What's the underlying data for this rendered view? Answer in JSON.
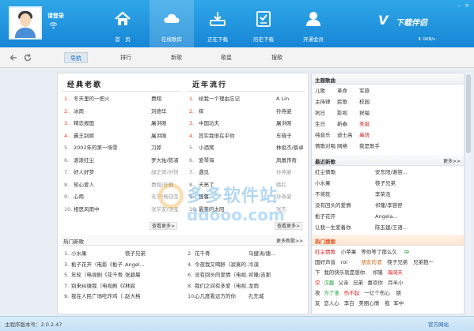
{
  "header": {
    "login_text": "请登录",
    "logo_text": "下载伴侣",
    "logo_mark": "V",
    "speed": "0KB/s",
    "nav": [
      {
        "label": "首　页",
        "icon": "home-icon"
      },
      {
        "label": "在线歌库",
        "icon": "cloud-icon"
      },
      {
        "label": "正在下载",
        "icon": "download-icon"
      },
      {
        "label": "历史下载",
        "icon": "history-icon"
      },
      {
        "label": "开通会员",
        "icon": "member-icon"
      }
    ]
  },
  "tabs": [
    "导航",
    "排行",
    "新歌",
    "歌星",
    "搜歌"
  ],
  "classic": {
    "title": "经典老歌",
    "more": "查看更多>",
    "songs": [
      {
        "n": "1.",
        "title": "冬天里的一把火",
        "artist": "费翔"
      },
      {
        "n": "2.",
        "title": "冰雨",
        "artist": "刘德华"
      },
      {
        "n": "3.",
        "title": "精忠报国",
        "artist": "屠洪刚"
      },
      {
        "n": "4.",
        "title": "霸王别姬",
        "artist": "屠洪刚"
      },
      {
        "n": "5.",
        "title": "2002年的第一场雪",
        "artist": "刀郎"
      },
      {
        "n": "6.",
        "title": "滚滚红尘",
        "artist": "罗大佑/陈淑..."
      },
      {
        "n": "7.",
        "title": "好人好梦",
        "artist": "邰正宵/孙悦"
      },
      {
        "n": "8.",
        "title": "知心爱人",
        "artist": "费翔/任静"
      },
      {
        "n": "9.",
        "title": "心雨",
        "artist": "毛宁/杨钰莹"
      },
      {
        "n": "10.",
        "title": "相思风雨中",
        "artist": "张学友/汤宝..."
      }
    ]
  },
  "recent": {
    "title": "近年流行",
    "more": "查看更多>",
    "songs": [
      {
        "n": "1.",
        "title": "给我一个理由忘记",
        "artist": "A Lin"
      },
      {
        "n": "2.",
        "title": "痒",
        "artist": "孙燕姿"
      },
      {
        "n": "3.",
        "title": "中国功夫",
        "artist": "屠洪刚"
      },
      {
        "n": "4.",
        "title": "其实我很在乎你",
        "artist": "车晓子"
      },
      {
        "n": "5.",
        "title": "小酒窝",
        "artist": "林俊杰/蔡卓..."
      },
      {
        "n": "6.",
        "title": "爱琴海",
        "artist": "凤凰传奇"
      },
      {
        "n": "7.",
        "title": "遇见",
        "artist": "孙燕姿"
      },
      {
        "n": "8.",
        "title": "天亮了",
        "artist": "韩红"
      },
      {
        "n": "9.",
        "title": "怪鲁",
        "artist": "孙燕姿"
      },
      {
        "n": "10.",
        "title": "最美的太阳",
        "artist": "张杰"
      }
    ]
  },
  "hot_new": {
    "title": "热门新歌",
    "more": "更多新歌>>",
    "left": [
      {
        "n": "1.",
        "title": "小水果",
        "artist": "筷子兄弟"
      },
      {
        "n": "3.",
        "title": "栀子花开（电影《栀子...",
        "artist": "Angel..."
      },
      {
        "n": "5.",
        "title": "年轮（电视剧《花千骨...",
        "artist": "张碧晨"
      },
      {
        "n": "7.",
        "title": "别来纠缠我（电视剧《花...",
        "artist": "林宸"
      },
      {
        "n": "9.",
        "title": "我在人民广场吃炸鸡（...",
        "artist": "赵大格"
      }
    ],
    "right": [
      {
        "n": "2.",
        "title": "花千骨",
        "artist": "马健涛/唐..."
      },
      {
        "n": "4.",
        "title": "今夜我又喝醉（寂寞的...",
        "artist": "冷漠"
      },
      {
        "n": "6.",
        "title": "没有回头的爱情（电视...",
        "artist": "祁隆/吉那"
      },
      {
        "n": "8.",
        "title": "我们之间有多爱（电视...",
        "artist": "龙雨"
      },
      {
        "n": "10.",
        "title": "心几度看远方的你",
        "artist": "孔先城"
      }
    ]
  },
  "sidebar": {
    "topic_title": "主题歌曲",
    "topics": [
      {
        "text": "儿歌",
        "red": false
      },
      {
        "text": "革命",
        "red": false
      },
      {
        "text": "军旅",
        "red": false
      },
      {
        "text": "主持律",
        "red": false
      },
      {
        "text": "民歌",
        "red": false
      },
      {
        "text": "校园",
        "red": false
      },
      {
        "text": "抗日",
        "red": false
      },
      {
        "text": "影视",
        "red": false
      },
      {
        "text": "祝福",
        "red": false
      },
      {
        "text": "生日",
        "red": false
      },
      {
        "text": "新春",
        "red": false
      },
      {
        "text": "圣诞",
        "red": true
      },
      {
        "text": "纯音乐",
        "red": false
      },
      {
        "text": "迪士高",
        "red": false
      },
      {
        "text": "串烧",
        "red": true
      },
      {
        "text": "情歌对唱",
        "red": false
      },
      {
        "text": "网络",
        "red": false
      },
      {
        "text": "我是歌手",
        "red": false
      }
    ],
    "recent_title": "最近新歌",
    "recent_more": "更多>>",
    "recent_songs": [
      "红尘情歌",
      "安东阳/谢容...",
      "小水果",
      "筷子兄弟",
      "不将就",
      "李荣浩",
      "没有回头的爱情",
      "祁隆/李容舒",
      "栀子花开",
      "Angela...",
      "让我一生爱着你",
      "陈玉建/王语..."
    ],
    "search_title": "热门搜索",
    "search_words": [
      {
        "text": "红尘情歌",
        "c": "#d21e1e"
      },
      {
        "text": "小苹果",
        "c": "#333"
      },
      {
        "text": "等你等了那么久",
        "c": "#333"
      },
      {
        "text": "中",
        "c": "#1a9e3a"
      },
      {
        "text": "国好声音",
        "c": "#333"
      },
      {
        "text": "roi",
        "c": "#333"
      },
      {
        "text": "朋友的酒",
        "c": "#d2691e"
      },
      {
        "text": "筷子兄弟",
        "c": "#333"
      },
      {
        "text": "兄弟抱一",
        "c": "#333"
      },
      {
        "text": "下",
        "c": "#333"
      },
      {
        "text": "我的快乐就是想你",
        "c": "#333"
      },
      {
        "text": "祁隆",
        "c": "#333"
      },
      {
        "text": "海阔天",
        "c": "#d21e1e"
      },
      {
        "text": "空",
        "c": "#d21e1e"
      },
      {
        "text": "汉趣",
        "c": "#1a9e3a"
      },
      {
        "text": "父亲",
        "c": "#333"
      },
      {
        "text": "兄弟",
        "c": "#333"
      },
      {
        "text": "喜欢你",
        "c": "#333"
      },
      {
        "text": "月半小",
        "c": "#333"
      },
      {
        "text": "夜",
        "c": "#333"
      },
      {
        "text": "为了谁",
        "c": "#1a9e3a"
      },
      {
        "text": "伤不起",
        "c": "#d21e1e"
      },
      {
        "text": "一亿个伤心",
        "c": "#333"
      },
      {
        "text": "朋",
        "c": "#333"
      },
      {
        "text": "友",
        "c": "#333"
      },
      {
        "text": "恋人心",
        "c": "#333"
      },
      {
        "text": "李白",
        "c": "#333"
      },
      {
        "text": "美丽心情",
        "c": "#333"
      },
      {
        "text": "我",
        "c": "#333"
      },
      {
        "text": "军中",
        "c": "#333"
      }
    ]
  },
  "watermark": {
    "line1": "多多软件站",
    "line2": "ddooo.com"
  },
  "status": {
    "version": "主程序版本号：2.0.2.47",
    "site": "官方网站",
    "below": "阳光彩虹    我要找歌名"
  }
}
